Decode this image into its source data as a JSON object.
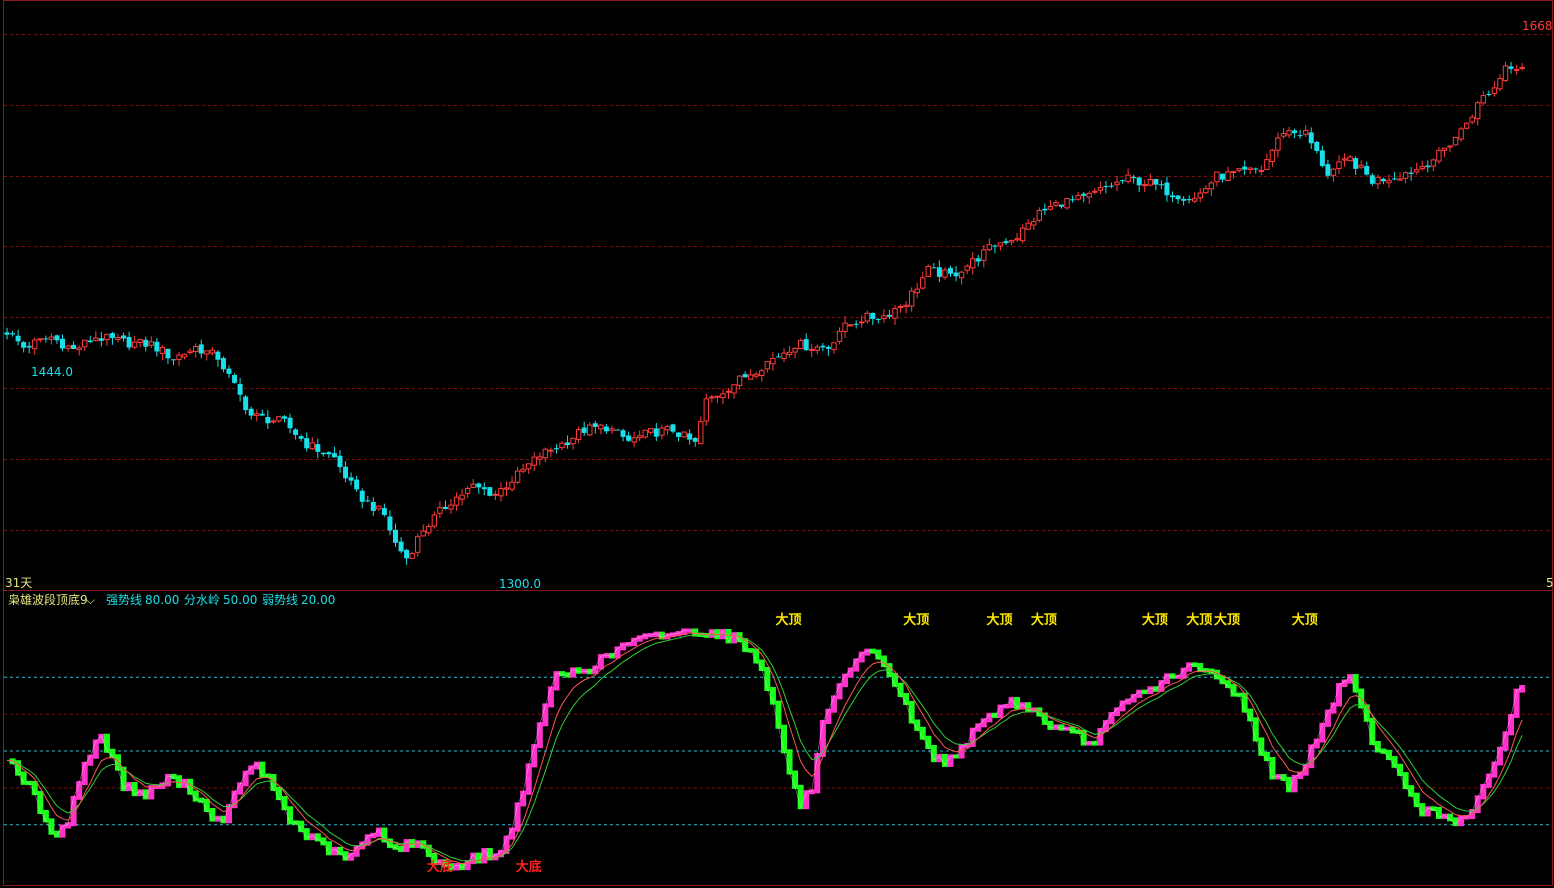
{
  "chart_data": [
    {
      "type": "candlestick",
      "title": "",
      "price_range": [
        1300.0,
        1668.0
      ],
      "max_label": "1668.",
      "min_label": "1300.0",
      "low_left_label": "1444.0",
      "period_label": "31天",
      "right_edge_label": "5",
      "grid": "dashed-horizontal",
      "colors": {
        "up": "#ff3b3b",
        "down": "#19e0e8",
        "grid": "#7a1010",
        "border": "#8b1a1a"
      },
      "close_path": [
        [
          0,
          1459
        ],
        [
          3,
          1448
        ],
        [
          8,
          1455
        ],
        [
          12,
          1446
        ],
        [
          16,
          1455
        ],
        [
          22,
          1451
        ],
        [
          26,
          1450
        ],
        [
          30,
          1440
        ],
        [
          34,
          1448
        ],
        [
          38,
          1441
        ],
        [
          44,
          1400
        ],
        [
          50,
          1395
        ],
        [
          54,
          1380
        ],
        [
          59,
          1370
        ],
        [
          63,
          1345
        ],
        [
          68,
          1330
        ],
        [
          70,
          1310
        ],
        [
          72,
          1300
        ],
        [
          75,
          1320
        ],
        [
          80,
          1340
        ],
        [
          84,
          1350
        ],
        [
          88,
          1345
        ],
        [
          92,
          1358
        ],
        [
          96,
          1372
        ],
        [
          100,
          1380
        ],
        [
          104,
          1390
        ],
        [
          108,
          1392
        ],
        [
          112,
          1382
        ],
        [
          116,
          1388
        ],
        [
          120,
          1390
        ],
        [
          124,
          1380
        ],
        [
          126,
          1410
        ],
        [
          130,
          1420
        ],
        [
          134,
          1430
        ],
        [
          138,
          1440
        ],
        [
          142,
          1450
        ],
        [
          146,
          1448
        ],
        [
          148,
          1448
        ],
        [
          150,
          1460
        ],
        [
          154,
          1468
        ],
        [
          158,
          1470
        ],
        [
          162,
          1480
        ],
        [
          166,
          1502
        ],
        [
          170,
          1498
        ],
        [
          174,
          1508
        ],
        [
          178,
          1520
        ],
        [
          182,
          1526
        ],
        [
          186,
          1542
        ],
        [
          190,
          1550
        ],
        [
          194,
          1552
        ],
        [
          198,
          1560
        ],
        [
          202,
          1566
        ],
        [
          206,
          1563
        ],
        [
          210,
          1556
        ],
        [
          214,
          1552
        ],
        [
          218,
          1568
        ],
        [
          222,
          1570
        ],
        [
          226,
          1573
        ],
        [
          230,
          1600
        ],
        [
          234,
          1598
        ],
        [
          238,
          1570
        ],
        [
          242,
          1580
        ],
        [
          246,
          1565
        ],
        [
          250,
          1568
        ],
        [
          254,
          1573
        ],
        [
          258,
          1583
        ],
        [
          262,
          1600
        ],
        [
          266,
          1624
        ],
        [
          268,
          1630
        ],
        [
          270,
          1646
        ],
        [
          273,
          1646
        ]
      ]
    },
    {
      "type": "bar+line",
      "title": "枭雄波段顶底9",
      "ylim": [
        0,
        100
      ],
      "levels": [
        {
          "label": "强势线",
          "value": "80.00",
          "y": 80
        },
        {
          "label": "分水岭",
          "value": "50.00",
          "y": 50
        },
        {
          "label": "弱势线",
          "value": "20.00",
          "y": 20
        }
      ],
      "top_label": "大顶",
      "bottom_label": "大底",
      "colors": {
        "rising": "#ff33cc",
        "falling": "#1aff1a",
        "level": "#33bbcc",
        "fast": "#ff5555",
        "slow": "#33cc33",
        "text": "#e6e680",
        "signal": "#ffea00",
        "bottom_signal": "#ff2222"
      },
      "osc_path": [
        [
          0,
          48
        ],
        [
          5,
          32
        ],
        [
          8,
          15
        ],
        [
          11,
          22
        ],
        [
          14,
          45
        ],
        [
          17,
          56
        ],
        [
          19,
          48
        ],
        [
          21,
          36
        ],
        [
          25,
          32
        ],
        [
          29,
          39
        ],
        [
          33,
          35
        ],
        [
          36,
          26
        ],
        [
          39,
          20
        ],
        [
          42,
          38
        ],
        [
          45,
          44
        ],
        [
          48,
          35
        ],
        [
          51,
          22
        ],
        [
          55,
          14
        ],
        [
          58,
          10
        ],
        [
          61,
          6
        ],
        [
          64,
          12
        ],
        [
          67,
          18
        ],
        [
          70,
          10
        ],
        [
          73,
          13
        ],
        [
          76,
          8
        ],
        [
          79,
          3
        ],
        [
          82,
          4
        ],
        [
          86,
          8
        ],
        [
          89,
          8
        ],
        [
          91,
          20
        ],
        [
          93,
          35
        ],
        [
          95,
          50
        ],
        [
          97,
          70
        ],
        [
          99,
          80
        ],
        [
          102,
          82
        ],
        [
          105,
          84
        ],
        [
          108,
          88
        ],
        [
          110,
          91
        ],
        [
          112,
          94
        ],
        [
          116,
          96
        ],
        [
          120,
          98
        ],
        [
          124,
          99
        ],
        [
          128,
          98
        ],
        [
          132,
          95
        ],
        [
          136,
          85
        ],
        [
          139,
          60
        ],
        [
          141,
          41
        ],
        [
          143,
          28
        ],
        [
          145,
          35
        ],
        [
          147,
          60
        ],
        [
          150,
          75
        ],
        [
          153,
          86
        ],
        [
          155,
          90
        ],
        [
          158,
          86
        ],
        [
          161,
          73
        ],
        [
          164,
          58
        ],
        [
          167,
          48
        ],
        [
          169,
          45
        ],
        [
          172,
          52
        ],
        [
          175,
          59
        ],
        [
          178,
          66
        ],
        [
          181,
          70
        ],
        [
          184,
          68
        ],
        [
          187,
          62
        ],
        [
          190,
          58
        ],
        [
          193,
          56
        ],
        [
          195,
          52
        ],
        [
          197,
          58
        ],
        [
          200,
          66
        ],
        [
          203,
          72
        ],
        [
          206,
          75
        ],
        [
          208,
          78
        ],
        [
          211,
          82
        ],
        [
          214,
          84
        ],
        [
          217,
          81
        ],
        [
          220,
          76
        ],
        [
          222,
          73
        ],
        [
          225,
          56
        ],
        [
          228,
          40
        ],
        [
          231,
          36
        ],
        [
          234,
          45
        ],
        [
          237,
          60
        ],
        [
          240,
          75
        ],
        [
          242,
          82
        ],
        [
          244,
          68
        ],
        [
          246,
          55
        ],
        [
          249,
          46
        ],
        [
          252,
          36
        ],
        [
          255,
          26
        ],
        [
          258,
          24
        ],
        [
          261,
          22
        ],
        [
          264,
          26
        ],
        [
          267,
          38
        ],
        [
          270,
          58
        ],
        [
          272,
          74
        ],
        [
          275,
          80
        ],
        [
          277,
          74
        ],
        [
          280,
          75
        ]
      ]
    }
  ]
}
